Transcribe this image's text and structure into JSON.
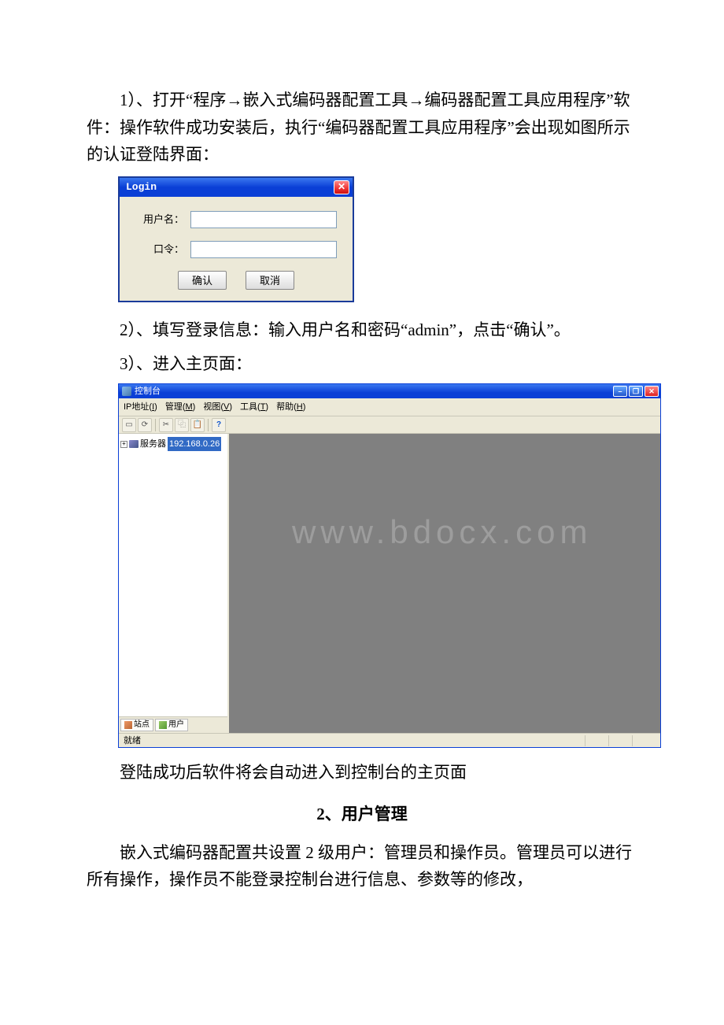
{
  "doc": {
    "p1": "1）、打开“程序→嵌入式编码器配置工具→编码器配置工具应用程序”软件：操作软件成功安装后，执行“编码器配置工具应用程序”会出现如图所示的认证登陆界面：",
    "p2": "2）、填写登录信息：输入用户名和密码“admin”，点击“确认”。",
    "p3": "3）、进入主页面：",
    "p4": "登陆成功后软件将会自动进入到控制台的主页面",
    "h2": "2、用户管理",
    "p5": "嵌入式编码器配置共设置 2 级用户：管理员和操作员。管理员可以进行所有操作，操作员不能登录控制台进行信息、参数等的修改，"
  },
  "login": {
    "title": "Login",
    "user_label": "用户名：",
    "pass_label": "口令：",
    "ok": "确认",
    "cancel": "取消"
  },
  "console": {
    "title": "控制台",
    "menu": {
      "ip": "IP地址",
      "ip_key": "I",
      "manage": "管理",
      "manage_key": "M",
      "view": "视图",
      "view_key": "V",
      "tool": "工具",
      "tool_key": "T",
      "help": "帮助",
      "help_key": "H"
    },
    "tree": {
      "root_label": "服务器",
      "root_ip": "192.168.0.26"
    },
    "tabs": {
      "site": "站点",
      "user": "用户"
    },
    "status": "就绪",
    "watermark": "www.bdocx.com"
  }
}
